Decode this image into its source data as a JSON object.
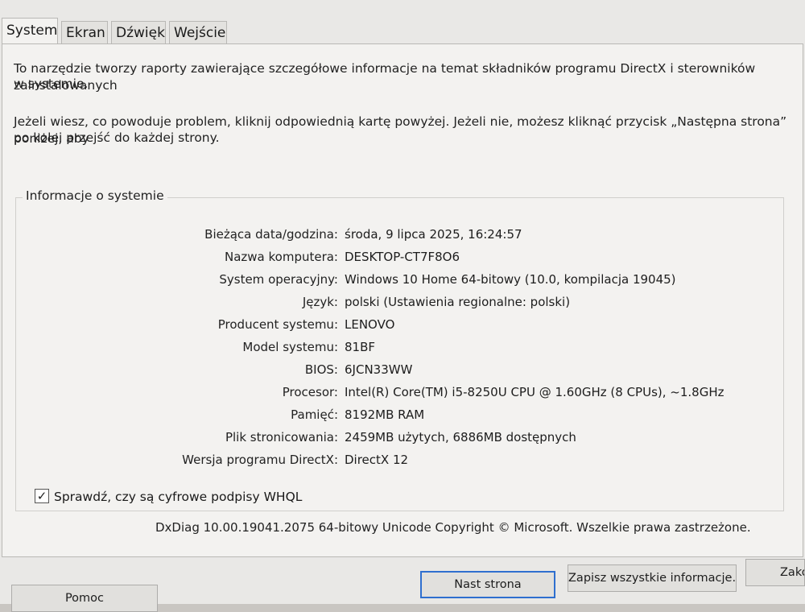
{
  "tabs": [
    {
      "label": "System"
    },
    {
      "label": "Ekran"
    },
    {
      "label": "Dźwięk"
    },
    {
      "label": "Wejście"
    }
  ],
  "intro": {
    "line1": "To narzędzie tworzy raporty zawierające szczegółowe informacje na temat składników programu DirectX i sterowników zainstalowanych",
    "line2": "w systemie.",
    "line3": "Jeżeli wiesz, co powoduje problem, kliknij odpowiednią kartę powyżej. Jeżeli nie, możesz kliknąć przycisk „Następna strona” poniżej, aby",
    "line4": "po kolei przejść do każdej strony."
  },
  "system_info": {
    "title": "Informacje o systemie",
    "rows": [
      {
        "label": "Bieżąca data/godzina:",
        "value": "środa, 9 lipca 2025, 16:24:57"
      },
      {
        "label": "Nazwa komputera:",
        "value": "DESKTOP-CT7F8O6"
      },
      {
        "label": "System operacyjny:",
        "value": "Windows 10 Home 64-bitowy (10.0, kompilacja 19045)"
      },
      {
        "label": "Język:",
        "value": "polski (Ustawienia regionalne: polski)"
      },
      {
        "label": "Producent systemu:",
        "value": "LENOVO"
      },
      {
        "label": "Model systemu:",
        "value": "81BF"
      },
      {
        "label": "BIOS:",
        "value": "6JCN33WW"
      },
      {
        "label": "Procesor:",
        "value": "Intel(R) Core(TM) i5-8250U CPU @ 1.60GHz (8 CPUs), ~1.8GHz"
      },
      {
        "label": "Pamięć:",
        "value": "8192MB RAM"
      },
      {
        "label": "Plik stronicowania:",
        "value": "2459MB użytych, 6886MB dostępnych"
      },
      {
        "label": "Wersja programu DirectX:",
        "value": "DirectX 12"
      }
    ]
  },
  "whql_check": {
    "label": "Sprawdź, czy są cyfrowe podpisy WHQL",
    "checked": true,
    "mark": "✓"
  },
  "footer_note": "DxDiag 10.00.19041.2075 64-bitowy Unicode  Copyright © Microsoft. Wszelkie prawa zastrzeżone.",
  "buttons": {
    "help": "Pomoc",
    "next_page": "Nast strona",
    "save_all": "Zapisz wszystkie informacje...",
    "close": "Zako"
  }
}
